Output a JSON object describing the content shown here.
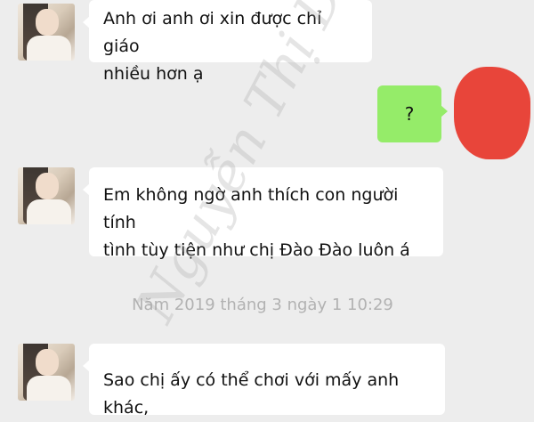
{
  "messages": [
    {
      "side": "left",
      "line1": "Anh ơi anh ơi xin được chỉ giáo",
      "line2": "nhiều hơn ạ"
    },
    {
      "side": "right",
      "text": "?"
    },
    {
      "side": "left",
      "line1": "Em không ngờ anh thích con người tính",
      "line2": "tình tùy tiện như chị Đào Đào luôn á"
    },
    {
      "side": "left",
      "line1": "Sao chị ấy có thể chơi với mấy anh khác,"
    }
  ],
  "timestamp": "Năm 2019 tháng 3 ngày 1 10:29",
  "watermark": "Nguyễn Thị Dâu",
  "colors": {
    "background": "#ededed",
    "incoming_bubble": "#ffffff",
    "outgoing_bubble": "#95ec69",
    "redaction": "#e8453a",
    "timestamp": "#b2b2b2"
  }
}
